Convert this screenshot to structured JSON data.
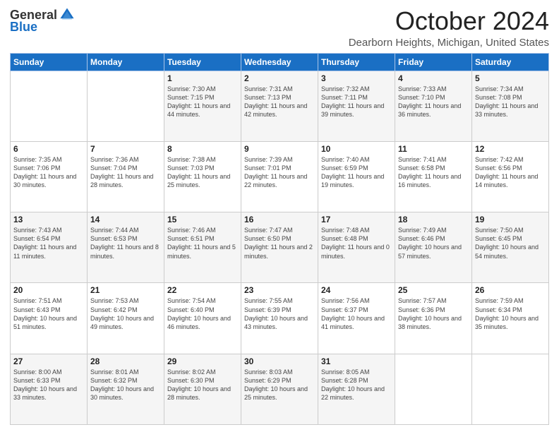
{
  "logo": {
    "general": "General",
    "blue": "Blue"
  },
  "header": {
    "month": "October 2024",
    "location": "Dearborn Heights, Michigan, United States"
  },
  "days_of_week": [
    "Sunday",
    "Monday",
    "Tuesday",
    "Wednesday",
    "Thursday",
    "Friday",
    "Saturday"
  ],
  "weeks": [
    [
      {
        "day": "",
        "info": ""
      },
      {
        "day": "",
        "info": ""
      },
      {
        "day": "1",
        "info": "Sunrise: 7:30 AM\nSunset: 7:15 PM\nDaylight: 11 hours and 44 minutes."
      },
      {
        "day": "2",
        "info": "Sunrise: 7:31 AM\nSunset: 7:13 PM\nDaylight: 11 hours and 42 minutes."
      },
      {
        "day": "3",
        "info": "Sunrise: 7:32 AM\nSunset: 7:11 PM\nDaylight: 11 hours and 39 minutes."
      },
      {
        "day": "4",
        "info": "Sunrise: 7:33 AM\nSunset: 7:10 PM\nDaylight: 11 hours and 36 minutes."
      },
      {
        "day": "5",
        "info": "Sunrise: 7:34 AM\nSunset: 7:08 PM\nDaylight: 11 hours and 33 minutes."
      }
    ],
    [
      {
        "day": "6",
        "info": "Sunrise: 7:35 AM\nSunset: 7:06 PM\nDaylight: 11 hours and 30 minutes."
      },
      {
        "day": "7",
        "info": "Sunrise: 7:36 AM\nSunset: 7:04 PM\nDaylight: 11 hours and 28 minutes."
      },
      {
        "day": "8",
        "info": "Sunrise: 7:38 AM\nSunset: 7:03 PM\nDaylight: 11 hours and 25 minutes."
      },
      {
        "day": "9",
        "info": "Sunrise: 7:39 AM\nSunset: 7:01 PM\nDaylight: 11 hours and 22 minutes."
      },
      {
        "day": "10",
        "info": "Sunrise: 7:40 AM\nSunset: 6:59 PM\nDaylight: 11 hours and 19 minutes."
      },
      {
        "day": "11",
        "info": "Sunrise: 7:41 AM\nSunset: 6:58 PM\nDaylight: 11 hours and 16 minutes."
      },
      {
        "day": "12",
        "info": "Sunrise: 7:42 AM\nSunset: 6:56 PM\nDaylight: 11 hours and 14 minutes."
      }
    ],
    [
      {
        "day": "13",
        "info": "Sunrise: 7:43 AM\nSunset: 6:54 PM\nDaylight: 11 hours and 11 minutes."
      },
      {
        "day": "14",
        "info": "Sunrise: 7:44 AM\nSunset: 6:53 PM\nDaylight: 11 hours and 8 minutes."
      },
      {
        "day": "15",
        "info": "Sunrise: 7:46 AM\nSunset: 6:51 PM\nDaylight: 11 hours and 5 minutes."
      },
      {
        "day": "16",
        "info": "Sunrise: 7:47 AM\nSunset: 6:50 PM\nDaylight: 11 hours and 2 minutes."
      },
      {
        "day": "17",
        "info": "Sunrise: 7:48 AM\nSunset: 6:48 PM\nDaylight: 11 hours and 0 minutes."
      },
      {
        "day": "18",
        "info": "Sunrise: 7:49 AM\nSunset: 6:46 PM\nDaylight: 10 hours and 57 minutes."
      },
      {
        "day": "19",
        "info": "Sunrise: 7:50 AM\nSunset: 6:45 PM\nDaylight: 10 hours and 54 minutes."
      }
    ],
    [
      {
        "day": "20",
        "info": "Sunrise: 7:51 AM\nSunset: 6:43 PM\nDaylight: 10 hours and 51 minutes."
      },
      {
        "day": "21",
        "info": "Sunrise: 7:53 AM\nSunset: 6:42 PM\nDaylight: 10 hours and 49 minutes."
      },
      {
        "day": "22",
        "info": "Sunrise: 7:54 AM\nSunset: 6:40 PM\nDaylight: 10 hours and 46 minutes."
      },
      {
        "day": "23",
        "info": "Sunrise: 7:55 AM\nSunset: 6:39 PM\nDaylight: 10 hours and 43 minutes."
      },
      {
        "day": "24",
        "info": "Sunrise: 7:56 AM\nSunset: 6:37 PM\nDaylight: 10 hours and 41 minutes."
      },
      {
        "day": "25",
        "info": "Sunrise: 7:57 AM\nSunset: 6:36 PM\nDaylight: 10 hours and 38 minutes."
      },
      {
        "day": "26",
        "info": "Sunrise: 7:59 AM\nSunset: 6:34 PM\nDaylight: 10 hours and 35 minutes."
      }
    ],
    [
      {
        "day": "27",
        "info": "Sunrise: 8:00 AM\nSunset: 6:33 PM\nDaylight: 10 hours and 33 minutes."
      },
      {
        "day": "28",
        "info": "Sunrise: 8:01 AM\nSunset: 6:32 PM\nDaylight: 10 hours and 30 minutes."
      },
      {
        "day": "29",
        "info": "Sunrise: 8:02 AM\nSunset: 6:30 PM\nDaylight: 10 hours and 28 minutes."
      },
      {
        "day": "30",
        "info": "Sunrise: 8:03 AM\nSunset: 6:29 PM\nDaylight: 10 hours and 25 minutes."
      },
      {
        "day": "31",
        "info": "Sunrise: 8:05 AM\nSunset: 6:28 PM\nDaylight: 10 hours and 22 minutes."
      },
      {
        "day": "",
        "info": ""
      },
      {
        "day": "",
        "info": ""
      }
    ]
  ]
}
